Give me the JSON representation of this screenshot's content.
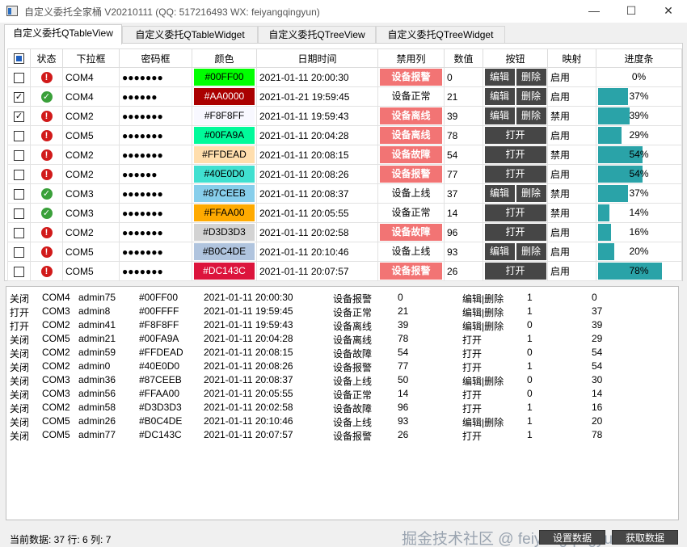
{
  "window": {
    "title": "自定义委托全家桶 V20210111 (QQ: 517216493 WX: feiyangqingyun)",
    "minimize": "—",
    "maximize": "☐",
    "close": "✕"
  },
  "tabs": [
    {
      "label": "自定义委托QTableView",
      "active": true
    },
    {
      "label": "自定义委托QTableWidget",
      "active": false
    },
    {
      "label": "自定义委托QTreeView",
      "active": false
    },
    {
      "label": "自定义委托QTreeWidget",
      "active": false
    }
  ],
  "table": {
    "headers": [
      "",
      "状态",
      "下拉框",
      "密码框",
      "颜色",
      "日期时间",
      "禁用列",
      "数值",
      "按钮",
      "映射",
      "进度条"
    ],
    "rows": [
      {
        "checked": false,
        "status": "error",
        "port": "COM4",
        "password": "●●●●●●●",
        "color": "#00FF00",
        "datetime": "2021-01-11 20:00:30",
        "state": "设备报警",
        "alarm": true,
        "value": "0",
        "buttons": [
          "编辑",
          "删除"
        ],
        "map": "启用",
        "progress": 0,
        "progress_text": "0%"
      },
      {
        "checked": true,
        "status": "ok",
        "port": "COM4",
        "password": "●●●●●●",
        "color": "#AA0000",
        "datetime": "2021-01-21 19:59:45",
        "state": "设备正常",
        "alarm": false,
        "value": "21",
        "buttons": [
          "编辑",
          "删除"
        ],
        "map": "启用",
        "progress": 37,
        "progress_text": "37%"
      },
      {
        "checked": true,
        "status": "error",
        "port": "COM2",
        "password": "●●●●●●●",
        "color": "#F8F8FF",
        "datetime": "2021-01-11 19:59:43",
        "state": "设备离线",
        "alarm": true,
        "value": "39",
        "buttons": [
          "编辑",
          "删除"
        ],
        "map": "禁用",
        "progress": 39,
        "progress_text": "39%"
      },
      {
        "checked": false,
        "status": "error",
        "port": "COM5",
        "password": "●●●●●●●",
        "color": "#00FA9A",
        "datetime": "2021-01-11 20:04:28",
        "state": "设备离线",
        "alarm": true,
        "value": "78",
        "buttons": [
          "打开"
        ],
        "map": "启用",
        "progress": 29,
        "progress_text": "29%"
      },
      {
        "checked": false,
        "status": "error",
        "port": "COM2",
        "password": "●●●●●●●",
        "color": "#FFDEAD",
        "datetime": "2021-01-11 20:08:15",
        "state": "设备故障",
        "alarm": true,
        "value": "54",
        "buttons": [
          "打开"
        ],
        "map": "禁用",
        "progress": 54,
        "progress_text": "54%"
      },
      {
        "checked": false,
        "status": "error",
        "port": "COM2",
        "password": "●●●●●●",
        "color": "#40E0D0",
        "datetime": "2021-01-11 20:08:26",
        "state": "设备报警",
        "alarm": true,
        "value": "77",
        "buttons": [
          "打开"
        ],
        "map": "启用",
        "progress": 54,
        "progress_text": "54%"
      },
      {
        "checked": false,
        "status": "ok",
        "port": "COM3",
        "password": "●●●●●●●",
        "color": "#87CEEB",
        "datetime": "2021-01-11 20:08:37",
        "state": "设备上线",
        "alarm": false,
        "value": "37",
        "buttons": [
          "编辑",
          "删除"
        ],
        "map": "禁用",
        "progress": 37,
        "progress_text": "37%"
      },
      {
        "checked": false,
        "status": "ok",
        "port": "COM3",
        "password": "●●●●●●●",
        "color": "#FFAA00",
        "datetime": "2021-01-11 20:05:55",
        "state": "设备正常",
        "alarm": false,
        "value": "14",
        "buttons": [
          "打开"
        ],
        "map": "禁用",
        "progress": 14,
        "progress_text": "14%"
      },
      {
        "checked": false,
        "status": "error",
        "port": "COM2",
        "password": "●●●●●●●",
        "color": "#D3D3D3",
        "datetime": "2021-01-11 20:02:58",
        "state": "设备故障",
        "alarm": true,
        "value": "96",
        "buttons": [
          "打开"
        ],
        "map": "启用",
        "progress": 16,
        "progress_text": "16%"
      },
      {
        "checked": false,
        "status": "error",
        "port": "COM5",
        "password": "●●●●●●●",
        "color": "#B0C4DE",
        "datetime": "2021-01-11 20:10:46",
        "state": "设备上线",
        "alarm": false,
        "value": "93",
        "buttons": [
          "编辑",
          "删除"
        ],
        "map": "启用",
        "progress": 20,
        "progress_text": "20%"
      },
      {
        "checked": false,
        "status": "error",
        "port": "COM5",
        "password": "●●●●●●●",
        "color": "#DC143C",
        "datetime": "2021-01-11 20:07:57",
        "state": "设备报警",
        "alarm": true,
        "value": "26",
        "buttons": [
          "打开"
        ],
        "map": "启用",
        "progress": 78,
        "progress_text": "78%"
      }
    ]
  },
  "log": [
    [
      "关闭",
      "COM4",
      "admin75",
      "#00FF00",
      "2021-01-11 20:00:30",
      "设备报警",
      "0",
      "编辑|删除",
      "1",
      "0"
    ],
    [
      "打开",
      "COM3",
      "admin8",
      "#00FFFF",
      "2021-01-11 19:59:45",
      "设备正常",
      "21",
      "编辑|删除",
      "1",
      "37"
    ],
    [
      "打开",
      "COM2",
      "admin41",
      "#F8F8FF",
      "2021-01-11 19:59:43",
      "设备离线",
      "39",
      "编辑|删除",
      "0",
      "39"
    ],
    [
      "关闭",
      "COM5",
      "admin21",
      "#00FA9A",
      "2021-01-11 20:04:28",
      "设备离线",
      "78",
      "打开",
      "1",
      "29"
    ],
    [
      "关闭",
      "COM2",
      "admin59",
      "#FFDEAD",
      "2021-01-11 20:08:15",
      "设备故障",
      "54",
      "打开",
      "0",
      "54"
    ],
    [
      "关闭",
      "COM2",
      "admin0",
      "#40E0D0",
      "2021-01-11 20:08:26",
      "设备报警",
      "77",
      "打开",
      "1",
      "54"
    ],
    [
      "关闭",
      "COM3",
      "admin36",
      "#87CEEB",
      "2021-01-11 20:08:37",
      "设备上线",
      "50",
      "编辑|删除",
      "0",
      "30"
    ],
    [
      "关闭",
      "COM3",
      "admin56",
      "#FFAA00",
      "2021-01-11 20:05:55",
      "设备正常",
      "14",
      "打开",
      "0",
      "14"
    ],
    [
      "关闭",
      "COM2",
      "admin58",
      "#D3D3D3",
      "2021-01-11 20:02:58",
      "设备故障",
      "96",
      "打开",
      "1",
      "16"
    ],
    [
      "关闭",
      "COM5",
      "admin26",
      "#B0C4DE",
      "2021-01-11 20:10:46",
      "设备上线",
      "93",
      "编辑|删除",
      "1",
      "20"
    ],
    [
      "关闭",
      "COM5",
      "admin77",
      "#DC143C",
      "2021-01-11 20:07:57",
      "设备报警",
      "26",
      "打开",
      "1",
      "78"
    ]
  ],
  "status": {
    "text": "当前数据: 37  行: 6  列: 7",
    "watermark": "掘金技术社区 @ feiyangqingyun",
    "set_button": "设置数据",
    "get_button": "获取数据"
  },
  "colors": {
    "accent": "#2AA3A8",
    "alarm": "#F27474",
    "button": "#464646",
    "error_icon": "#D11A1A",
    "ok_icon": "#3AA03A"
  }
}
